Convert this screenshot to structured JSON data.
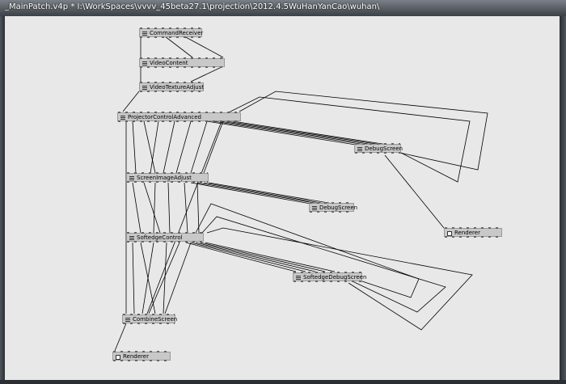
{
  "window": {
    "title": "_MainPatch.v4p * I:\\WorkSpaces\\vvvv_45beta27.1\\projection\\2012.4.5WuHanYanCao\\wuhan\\"
  },
  "nodes": {
    "command_receiver": "CommandReceiver",
    "video_content": "VideoContent",
    "video_texture_adjust": "VideoTextureAdjust",
    "projector_control_advanced": "ProjectorControlAdvanced",
    "debug_screen_1": "DebugScreen",
    "screen_image_adjust": "ScreenImageAdjust",
    "debug_screen_2": "DebugScreen",
    "renderer_1": "Renderer",
    "softedge_control": "SoftedgeControl",
    "softedge_debug_screen": "SoftedgeDebugScreen",
    "combine_screen": "CombineScreen",
    "renderer_2": "Renderer"
  },
  "colors": {
    "canvas": "#e8e8e8",
    "node": "#c8c8c8",
    "wire": "#000000"
  }
}
